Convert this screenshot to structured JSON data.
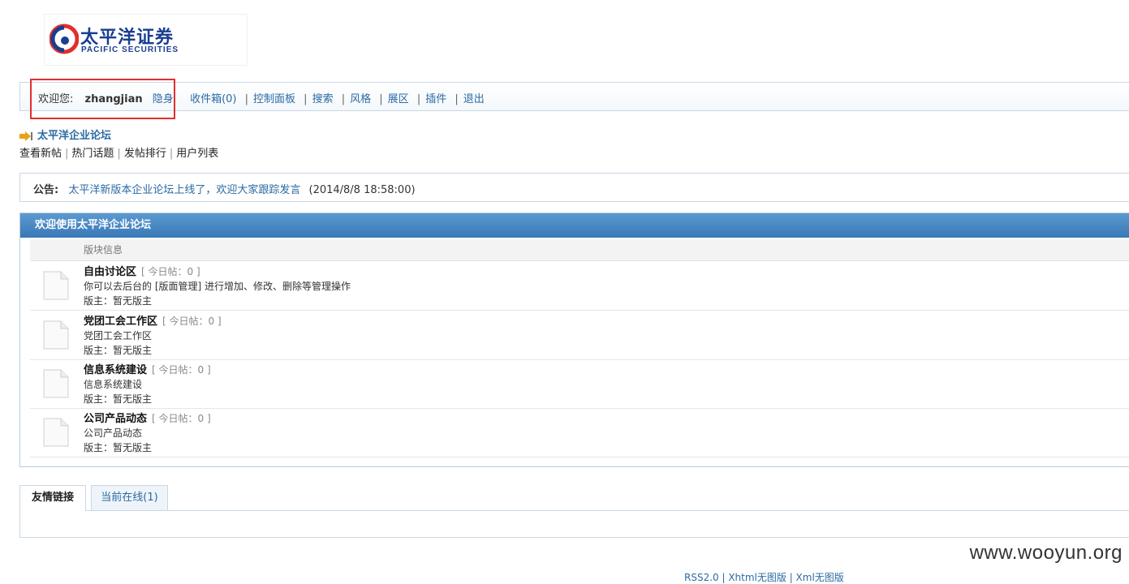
{
  "logo": {
    "cn": "太平洋证券",
    "en": "PACIFIC SECURITIES"
  },
  "userbar": {
    "welcome": "欢迎您:",
    "username": "zhangjian",
    "invisible": "隐身",
    "links": [
      "收件箱(0)",
      "控制面板",
      "搜索",
      "风格",
      "展区",
      "插件",
      "退出"
    ]
  },
  "forum": {
    "title": "太平洋企业论坛",
    "subnav": [
      "查看新帖",
      "热门话题",
      "发帖排行",
      "用户列表"
    ]
  },
  "announcement": {
    "label": "公告:",
    "text": "太平洋新版本企业论坛上线了，欢迎大家跟踪发言",
    "time": "(2014/8/8 18:58:00)"
  },
  "board": {
    "header": "欢迎使用太平洋企业论坛",
    "column": "版块信息",
    "rows": [
      {
        "name": "自由讨论区",
        "today": "[ 今日帖：0 ]",
        "desc": "你可以去后台的 [版面管理] 进行增加、修改、删除等管理操作",
        "mod": "版主：暂无版主"
      },
      {
        "name": "党团工会工作区",
        "today": "[ 今日帖：0 ]",
        "desc": "党团工会工作区",
        "mod": "版主：暂无版主"
      },
      {
        "name": "信息系统建设",
        "today": "[ 今日帖：0 ]",
        "desc": "信息系统建设",
        "mod": "版主：暂无版主"
      },
      {
        "name": "公司产品动态",
        "today": "[ 今日帖：0 ]",
        "desc": "公司产品动态",
        "mod": "版主：暂无版主"
      }
    ]
  },
  "tabs": {
    "links": "友情链接",
    "online": "当前在线(1)"
  },
  "watermark": "www.wooyun.org",
  "footer": "RSS2.0 | Xhtml无图版 | Xml无图版",
  "colors": {
    "accent": "#2b6aa3",
    "header_bg": "#3878b6",
    "highlight_border": "#e0302c"
  }
}
